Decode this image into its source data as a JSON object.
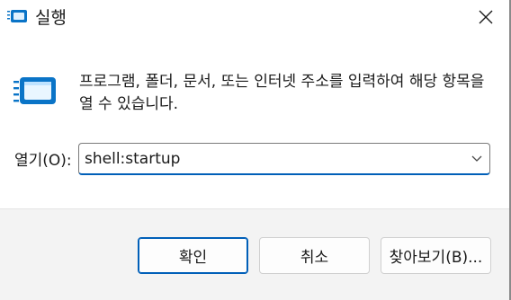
{
  "window": {
    "title": "실행",
    "icon": "run-icon",
    "close_icon": "close-icon"
  },
  "main": {
    "icon": "run-app-icon",
    "description": "프로그램, 폴더, 문서, 또는 인터넷 주소를 입력하여 해당 항목을 열 수 있습니다.",
    "open_label": "열기(O):",
    "open_value": "shell:startup",
    "dropdown_icon": "chevron-down-icon"
  },
  "buttons": {
    "ok": "확인",
    "cancel": "취소",
    "browse": "찾아보기(B)..."
  },
  "colors": {
    "accent": "#005fb8",
    "icon_blue": "#0a74c7",
    "footer_bg": "#f3f3f3"
  }
}
